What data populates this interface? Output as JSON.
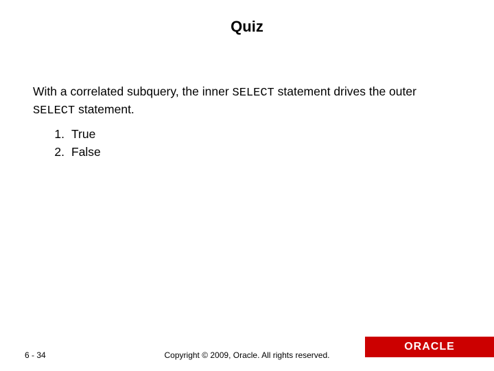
{
  "title": "Quiz",
  "question": {
    "part1": "With a correlated subquery, the inner ",
    "code1": "SELECT",
    "part2": " statement drives the outer ",
    "code2": "SELECT",
    "part3": " statement."
  },
  "options": [
    {
      "num": "1.",
      "label": "True"
    },
    {
      "num": "2.",
      "label": "False"
    }
  ],
  "footer": {
    "page": "6 - 34",
    "copyright": "Copyright © 2009, Oracle. All rights reserved.",
    "logo": "ORACLE"
  }
}
